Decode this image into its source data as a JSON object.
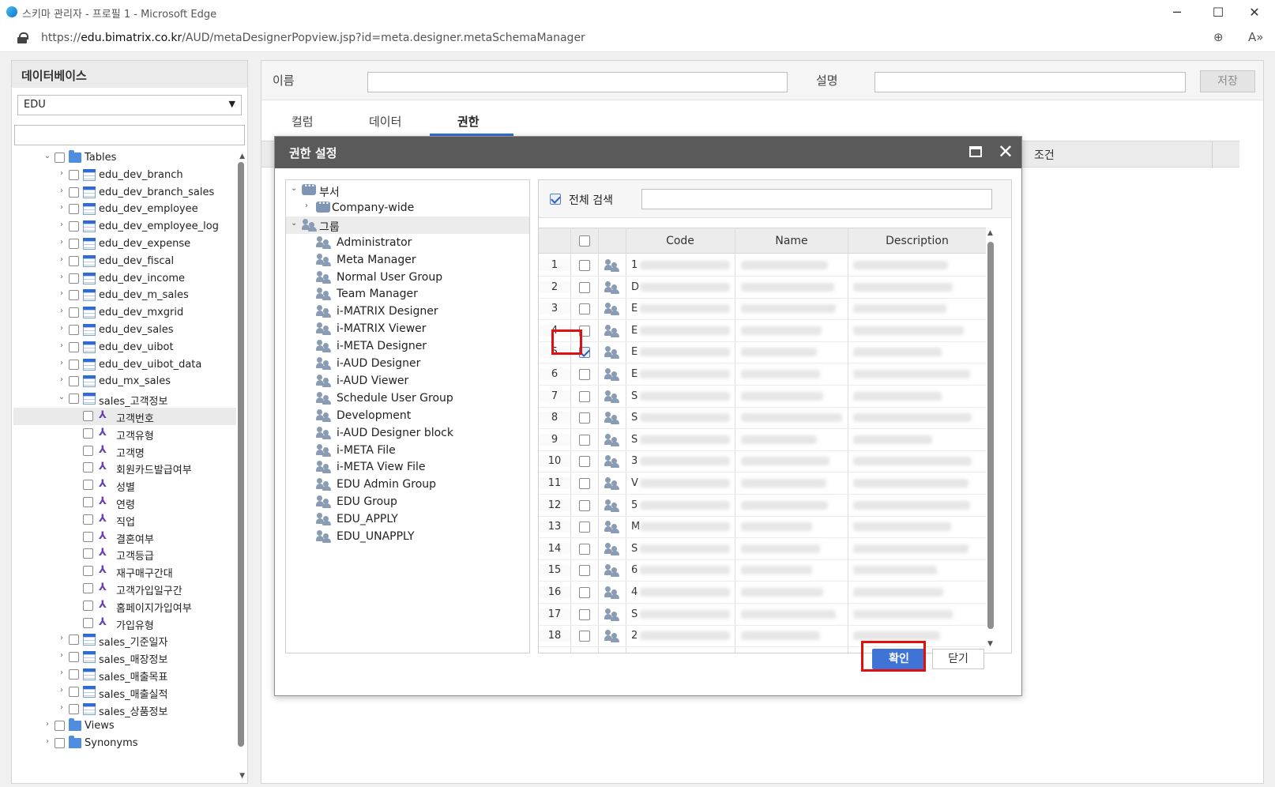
{
  "browser": {
    "title": "스키마 관리자 - 프로필 1 - Microsoft Edge",
    "url_prefix": "https://",
    "url_host": "edu.bimatrix.co.kr",
    "url_path": "/AUD/metaDesignerPopview.jsp?id=meta.designer.metaSchemaManager",
    "zoom_icon": "zoom-icon",
    "read_aloud_icon": "read-aloud-icon"
  },
  "left_panel": {
    "title": "데이터베이스",
    "db_selected": "EDU",
    "tree": {
      "tables_label": "Tables",
      "tables": [
        "edu_dev_branch",
        "edu_dev_branch_sales",
        "edu_dev_employee",
        "edu_dev_employee_log",
        "edu_dev_expense",
        "edu_dev_fiscal",
        "edu_dev_income",
        "edu_dev_m_sales",
        "edu_dev_mxgrid",
        "edu_dev_sales",
        "edu_dev_uibot",
        "edu_dev_uibot_data",
        "edu_mx_sales",
        "sales_고객정보"
      ],
      "columns": [
        "고객번호",
        "고객유형",
        "고객명",
        "회원카드발급여부",
        "성별",
        "연령",
        "직업",
        "결혼여부",
        "고객등급",
        "재구매구간대",
        "고객가입일구간",
        "홈페이지가입여부",
        "가입유형"
      ],
      "tables_after": [
        "sales_기준일자",
        "sales_매장정보",
        "sales_매출목표",
        "sales_매출실적",
        "sales_상품정보"
      ],
      "views_label": "Views",
      "synonyms_label": "Synonyms"
    }
  },
  "right_panel": {
    "name_label": "이름",
    "desc_label": "설명",
    "save_label": "저장",
    "tabs": [
      "컬럼",
      "데이터",
      "권한"
    ],
    "active_tab": "권한",
    "grid_condition_header": "조건"
  },
  "modal": {
    "title": "권한 설정",
    "tree": {
      "dept_label": "부서",
      "dept_children": [
        "Company-wide"
      ],
      "group_label": "그룹",
      "groups": [
        "Administrator",
        "Meta Manager",
        "Normal User Group",
        "Team Manager",
        "i-MATRIX Designer",
        "i-MATRIX Viewer",
        "i-META Designer",
        "i-AUD Designer",
        "i-AUD Viewer",
        "Schedule User Group",
        "Development",
        "i-AUD Designer block",
        "i-META File",
        "i-META View File",
        "EDU Admin Group",
        "EDU Group",
        "EDU_APPLY",
        "EDU_UNAPPLY"
      ]
    },
    "search": {
      "all_search_label": "전체 검색",
      "all_search_checked": true,
      "query": ""
    },
    "grid": {
      "headers": [
        "Code",
        "Name",
        "Description"
      ],
      "rows": [
        {
          "num": "1",
          "code": "1",
          "checked": false
        },
        {
          "num": "2",
          "code": "D",
          "checked": false
        },
        {
          "num": "3",
          "code": "E",
          "checked": false
        },
        {
          "num": "4",
          "code": "E",
          "checked": false
        },
        {
          "num": "5",
          "code": "E",
          "checked": true
        },
        {
          "num": "6",
          "code": "E",
          "checked": false
        },
        {
          "num": "7",
          "code": "S",
          "checked": false
        },
        {
          "num": "8",
          "code": "S",
          "checked": false
        },
        {
          "num": "9",
          "code": "S",
          "checked": false
        },
        {
          "num": "10",
          "code": "3",
          "checked": false
        },
        {
          "num": "11",
          "code": "V",
          "checked": false
        },
        {
          "num": "12",
          "code": "5",
          "checked": false
        },
        {
          "num": "13",
          "code": "M",
          "checked": false
        },
        {
          "num": "14",
          "code": "S",
          "checked": false
        },
        {
          "num": "15",
          "code": "6",
          "checked": false
        },
        {
          "num": "16",
          "code": "4",
          "checked": false
        },
        {
          "num": "17",
          "code": "S",
          "checked": false
        },
        {
          "num": "18",
          "code": "2",
          "checked": false
        }
      ]
    },
    "ok_label": "확인",
    "close_label": "닫기"
  },
  "colors": {
    "accent": "#3f74d6",
    "highlight": "#e01010",
    "modal_header": "#5a5a5a"
  }
}
